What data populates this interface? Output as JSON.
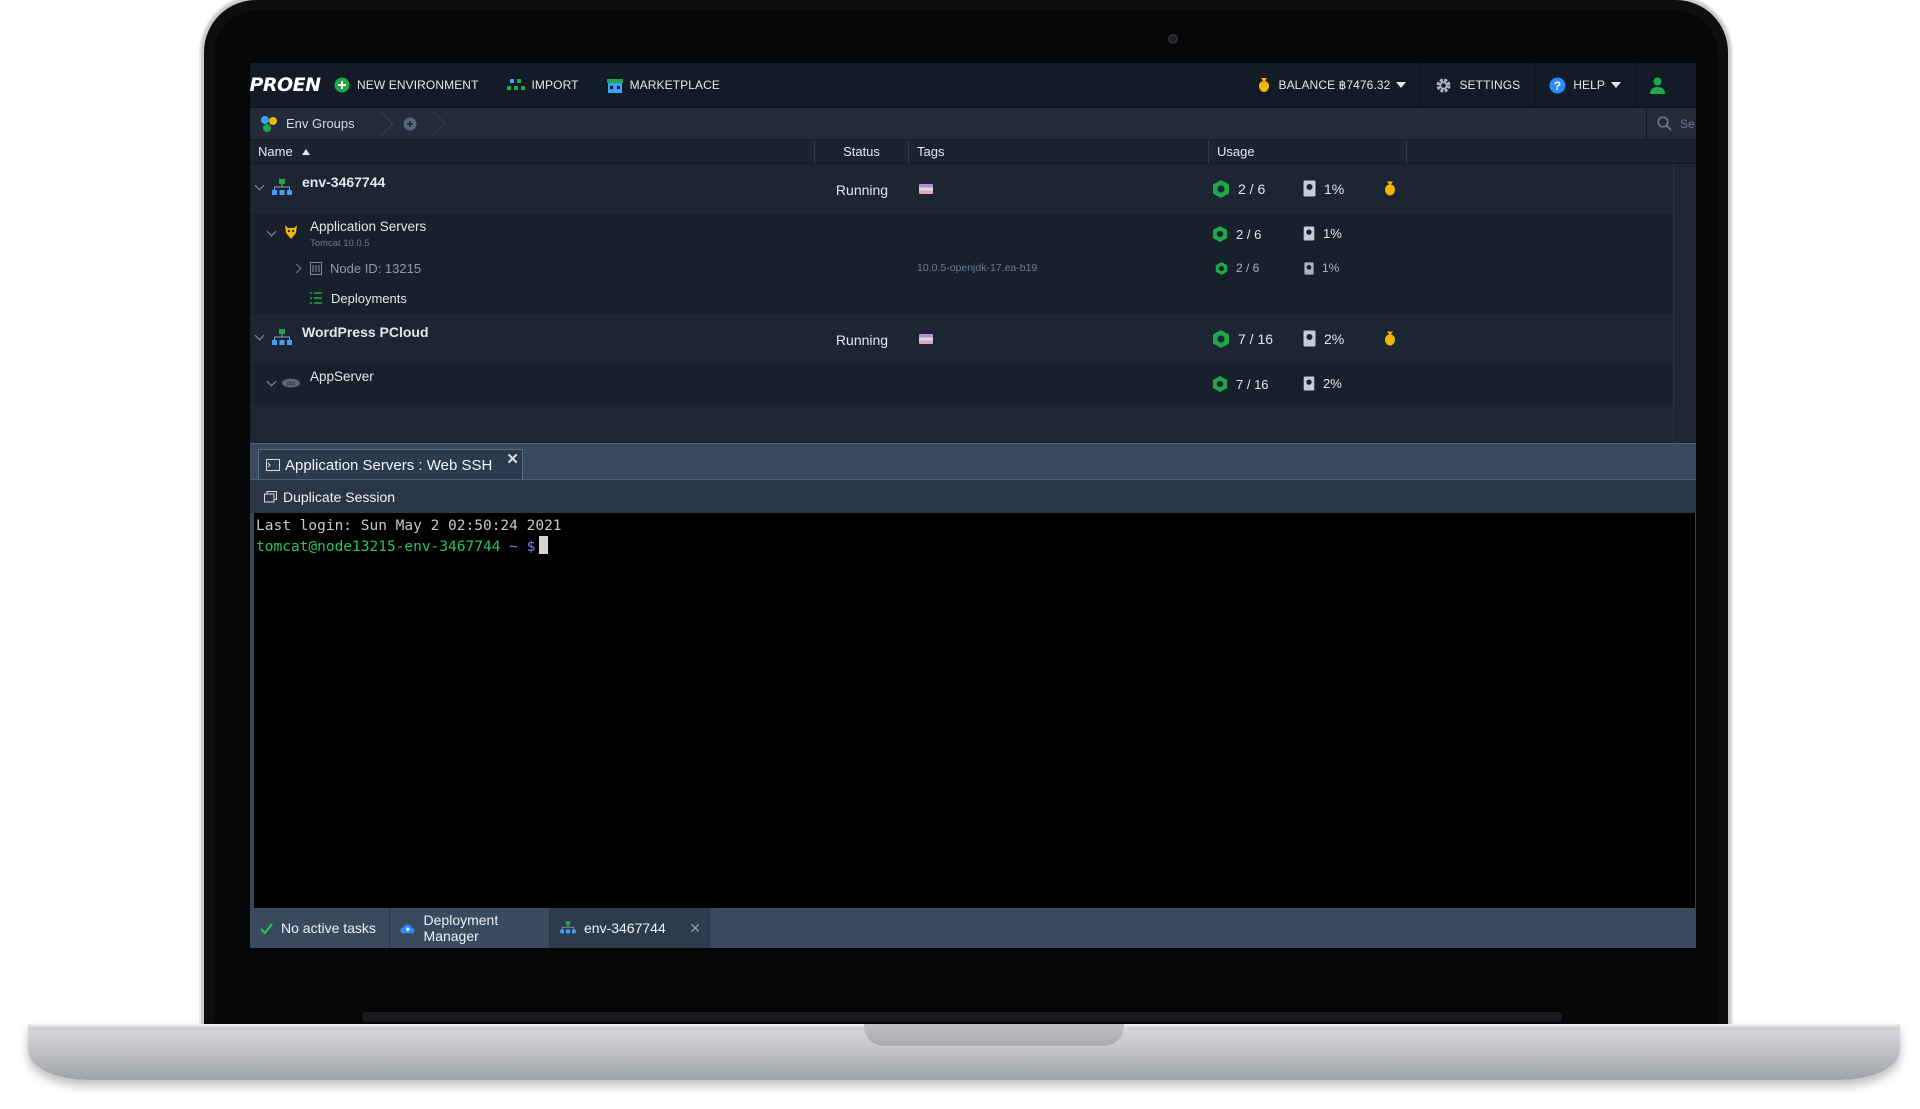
{
  "topbar": {
    "logo": "PROEN",
    "new_environment": "NEW ENVIRONMENT",
    "import": "IMPORT",
    "marketplace": "MARKETPLACE",
    "balance": "BALANCE ฿7476.32",
    "settings": "SETTINGS",
    "help": "HELP"
  },
  "breadcrumb": {
    "env_groups": "Env Groups",
    "search_placeholder": "Se"
  },
  "table": {
    "headers": {
      "name": "Name",
      "status": "Status",
      "tags": "Tags",
      "usage": "Usage"
    },
    "rows": [
      {
        "name": "env-3467744",
        "status": "Running",
        "cloudlets": "2 / 6",
        "disk": "1%"
      },
      {
        "name": "Application Servers",
        "sub": "Tomcat 10.0.5",
        "cloudlets": "2 / 6",
        "disk": "1%"
      },
      {
        "name": "Node ID: 13215",
        "tag_text": "10.0.5-openjdk-17.ea-b19",
        "cloudlets": "2 / 6",
        "disk": "1%"
      },
      {
        "name": "Deployments"
      },
      {
        "name": "WordPress PCloud",
        "status": "Running",
        "cloudlets": "7 / 16",
        "disk": "2%"
      },
      {
        "name": "AppServer",
        "cloudlets": "7 / 16",
        "disk": "2%"
      }
    ]
  },
  "ssh": {
    "tab_title": "Application Servers : Web SSH",
    "close": "✕",
    "duplicate": "Duplicate Session",
    "last_login": "Last login: Sun May  2 02:50:24 2021",
    "prompt_user": "tomcat@node13215-env-3467744",
    "prompt_tail": " ~ $"
  },
  "statusbar": {
    "tasks": "No active tasks",
    "deployment_manager": "Deployment Manager",
    "env_tab": "env-3467744",
    "close": "✕"
  },
  "colors": {
    "accent_green": "#22c55e",
    "cloudlet_green": "#1fa84a",
    "balance_gold": "#f2b705",
    "help_blue": "#2a8cff"
  }
}
